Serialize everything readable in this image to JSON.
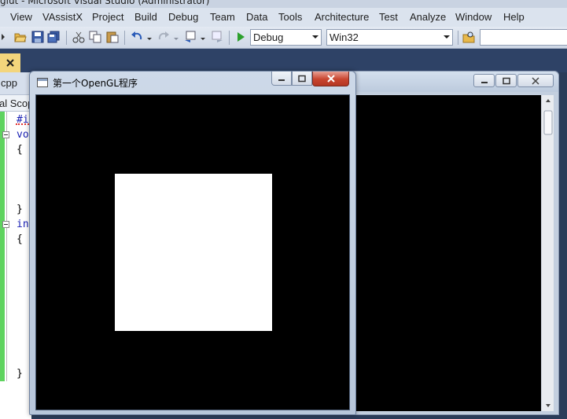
{
  "ide": {
    "title": "glut - Microsoft Visual Studio (Administrator)",
    "menu": [
      "View",
      "VAssistX",
      "Project",
      "Build",
      "Debug",
      "Team",
      "Data",
      "Tools",
      "Architecture",
      "Test",
      "Analyze",
      "Window",
      "Help"
    ],
    "toolbar": {
      "config": "Debug",
      "platform": "Win32",
      "find_value": ""
    },
    "file_tab": "cpp",
    "scope": "al Scop",
    "code_lines": [
      {
        "kind": "kw",
        "text": "#i"
      },
      {
        "kind": "kw",
        "text": "vo"
      },
      {
        "kind": "plain",
        "text": "{"
      },
      {
        "kind": "plain",
        "text": "}"
      },
      {
        "kind": "kw",
        "text": "in"
      },
      {
        "kind": "plain",
        "text": "{"
      },
      {
        "kind": "plain",
        "text": "}"
      }
    ]
  },
  "gl_window": {
    "title": "第一个OpenGL程序",
    "canvas_color": "#000000",
    "square_color": "#ffffff"
  },
  "colors": {
    "accent": "#2e4266",
    "close_red": "#c8452f",
    "change_margin": "#5fd35f"
  }
}
